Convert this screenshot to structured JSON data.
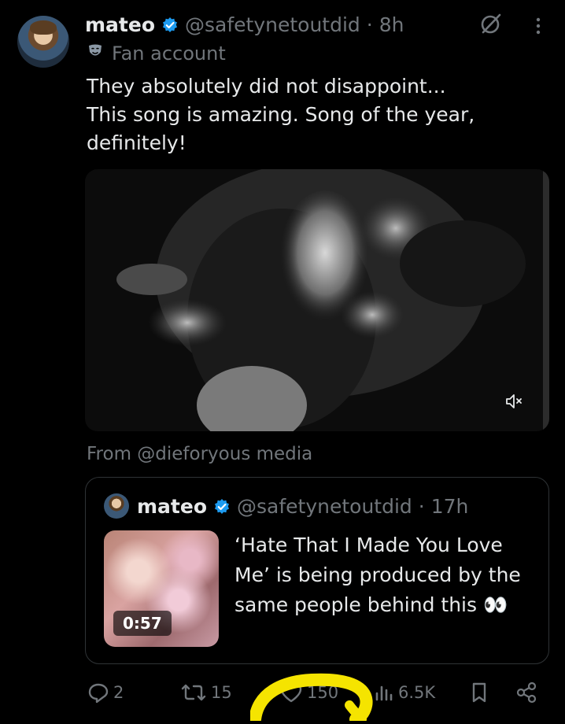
{
  "post": {
    "author": {
      "display_name": "mateo",
      "handle": "@safetynetoutdid",
      "time": "8h",
      "label": "Fan account"
    },
    "text_lines": [
      "They absolutely did not disappoint...",
      "This song is amazing. Song of the year,",
      "definitely!"
    ],
    "media_source": "From @dieforyous media",
    "icons": {
      "verified": "verified-badge-icon",
      "label": "theater-mask-icon",
      "grok": "grok-icon",
      "more": "more-icon",
      "mute": "mute-icon"
    }
  },
  "quote": {
    "author": {
      "display_name": "mateo",
      "handle": "@safetynetoutdid",
      "time": "17h"
    },
    "video_duration": "0:57",
    "text_lines": [
      "‘Hate That I Made You Love",
      "Me’ is being produced by the",
      "same people behind this 👀"
    ]
  },
  "actions": {
    "replies": "2",
    "reposts": "15",
    "likes": "150",
    "views": "6.5K"
  },
  "colors": {
    "background": "#000000",
    "text_primary": "#e7e9ea",
    "text_secondary": "#71767b",
    "verified": "#1d9bf0",
    "border": "#2f3336",
    "highlight": "#f5e400"
  }
}
